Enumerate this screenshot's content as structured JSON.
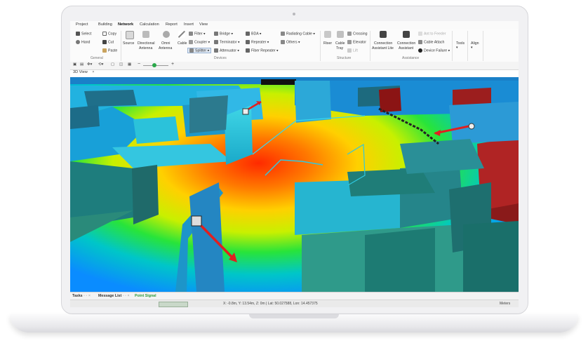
{
  "menu_tabs": [
    "Project",
    "Building",
    "Network",
    "Calculation",
    "Report",
    "Insert",
    "View"
  ],
  "active_tab": "Network",
  "ribbon": {
    "general": {
      "select": "Select",
      "hand": "Hand",
      "copy": "Copy",
      "cut": "Cut",
      "paste": "Paste",
      "group": "General"
    },
    "devices": {
      "source": "Source",
      "directional_1": "Directional",
      "directional_2": "Antenna",
      "omni_1": "Omni",
      "omni_2": "Antenna",
      "cable": "Cable",
      "filter": "Filter",
      "coupler": "Coupler",
      "splitter": "Splitter",
      "bridge": "Bridge",
      "terminator": "Terminator",
      "attenuator": "Attenuator",
      "bda": "BDA",
      "repeater": "Repeater",
      "fiber_repeater": "Fiber Repeater",
      "radiating_cable": "Radiating Cable",
      "others": "Others",
      "group": "Devices"
    },
    "structure": {
      "riser": "Riser",
      "cable_tray_1": "Cable",
      "cable_tray_2": "Tray",
      "crossing": "Crossing",
      "elevator": "Elevator",
      "lift": "Lift",
      "group": "Structure"
    },
    "assistance": {
      "conn_lite_1": "Connection",
      "conn_lite_2": "Assistant Lite",
      "conn_1": "Connection",
      "conn_2": "Assistant",
      "ant_to_feeder": "Ant to Feeder",
      "cable_attach": "Cable Attach",
      "device_failure": "Device Failure",
      "group": "Assistance"
    },
    "tools": "Tools",
    "align": "Align"
  },
  "document_tab": "3D View",
  "bottom_tabs": {
    "tasks": "Tasks",
    "message_list": "Message List",
    "point_signal": "Point Signal"
  },
  "status": {
    "coords": "X: -0.8m, Y: 13.54m, Z: 0m | Lat: 50.027588, Lon: 14.457375",
    "units": "Meters"
  },
  "colors": {
    "accent": "#1a7a3a",
    "heat_high": "#ff3a00",
    "heat_mid": "#ffe600",
    "heat_low": "#00b8ff",
    "wall": "#2cc6c6"
  }
}
